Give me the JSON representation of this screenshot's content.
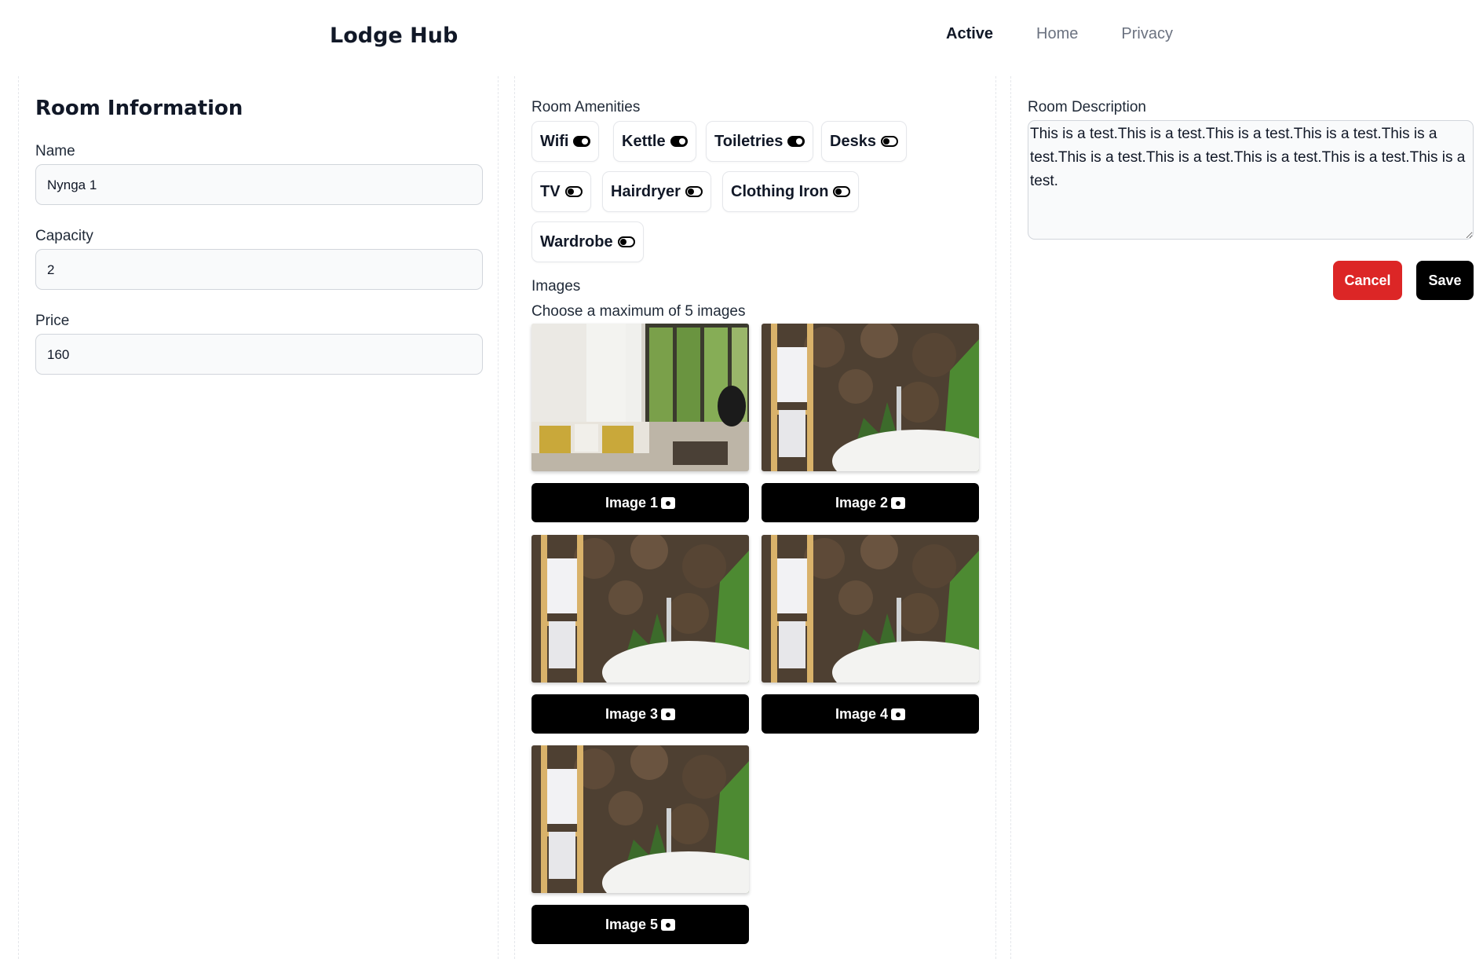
{
  "nav": {
    "brand": "Lodge Hub",
    "links": [
      "Active",
      "Home",
      "Privacy"
    ]
  },
  "room_info": {
    "title": "Room Information",
    "name_label": "Name",
    "name_value": "Nynga 1",
    "capacity_label": "Capacity",
    "capacity_value": "2",
    "price_label": "Price",
    "price_value": "160"
  },
  "amenities": {
    "label": "Room Amenities",
    "items": [
      {
        "label": "Wifi",
        "on": true
      },
      {
        "label": "Kettle",
        "on": true
      },
      {
        "label": "Toiletries",
        "on": true
      },
      {
        "label": "Desks",
        "on": false
      },
      {
        "label": "TV",
        "on": false
      },
      {
        "label": "Hairdryer",
        "on": false
      },
      {
        "label": "Clothing Iron",
        "on": false
      },
      {
        "label": "Wardrobe",
        "on": false
      }
    ]
  },
  "images": {
    "label": "Images",
    "hint": "Choose a maximum of 5 images",
    "buttons": [
      "Image 1",
      "Image 2",
      "Image 3",
      "Image 4",
      "Image 5"
    ]
  },
  "description": {
    "label": "Room Description",
    "value": "This is a test.This is a test.This is a test.This is a test.This is a test.This is a test.This is a test.This is a test.This is a test.This is a test."
  },
  "actions": {
    "cancel": "Cancel",
    "save": "Save"
  },
  "colors": {
    "cancel": "#dc2626",
    "primary": "#000000"
  }
}
